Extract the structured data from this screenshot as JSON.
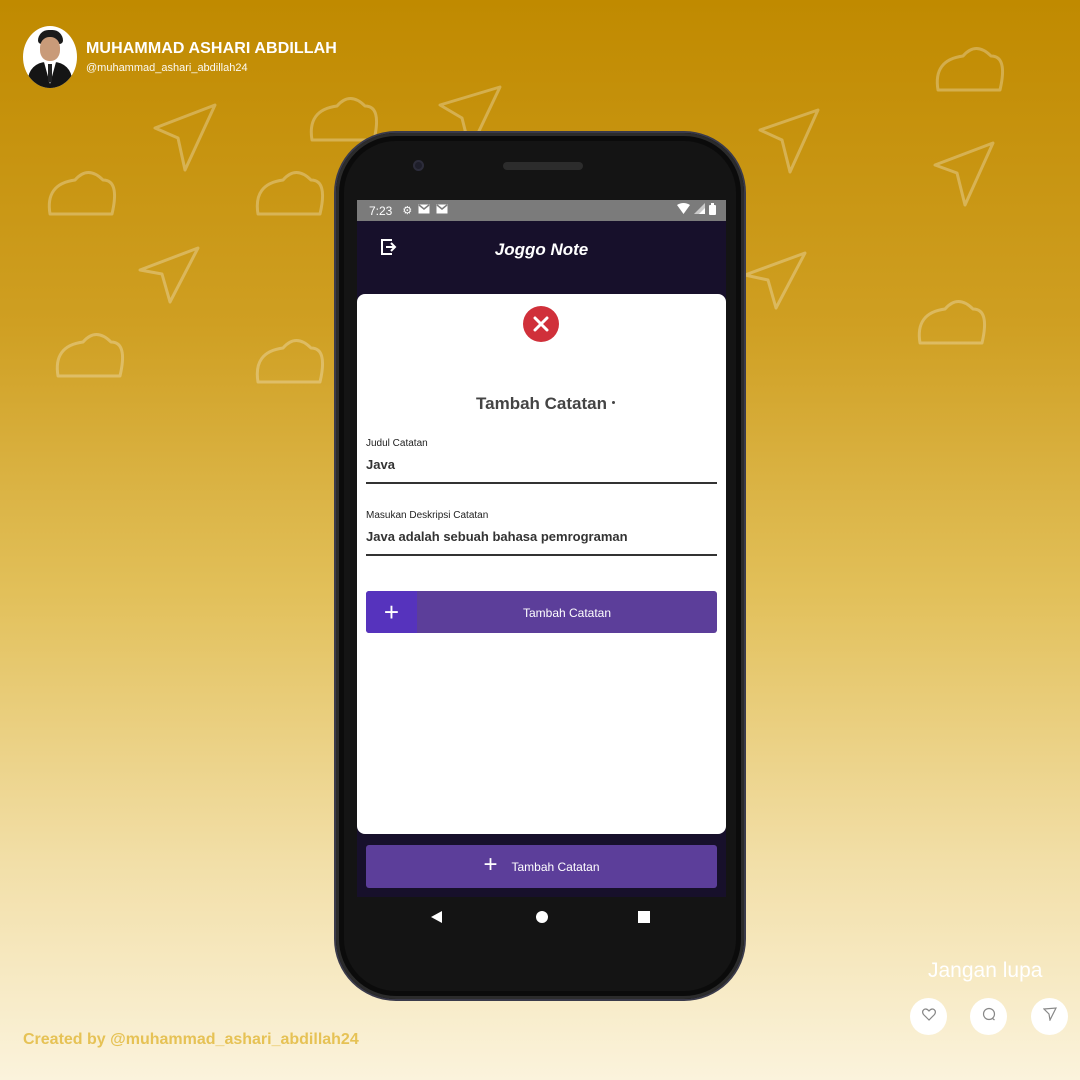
{
  "author": {
    "name": "MUHAMMAD ASHARI ABDILLAH",
    "handle": "@muhammad_ashari_abdillah24"
  },
  "statusbar": {
    "time": "7:23"
  },
  "app": {
    "title": "Joggo Note"
  },
  "dialog": {
    "title": "Tambah Catatan",
    "title_field": {
      "label": "Judul Catatan",
      "value": "Java"
    },
    "desc_field": {
      "label": "Masukan Deskripsi Catatan",
      "value": "Java adalah sebuah bahasa pemrograman"
    },
    "submit_label": "Tambah Catatan"
  },
  "main": {
    "add_label": "Tambah Catatan"
  },
  "footer": {
    "credit": "Created by @muhammad_ashari_abdillah24",
    "reminder": "Jangan lupa",
    "social": [
      "",
      "",
      ""
    ]
  },
  "colors": {
    "background_top": "#c08a00",
    "background_bottom": "#fbf3dc",
    "appbar": "#17102b",
    "button": "#5c3e9a",
    "button_icon": "#5633bd",
    "close": "#d0303a"
  },
  "icons": [
    "exit-icon",
    "close-icon",
    "plus-icon",
    "settings-icon",
    "gmail-icon",
    "wifi-icon",
    "signal-icon",
    "battery-icon",
    "heart-icon",
    "comment-icon",
    "send-icon"
  ]
}
